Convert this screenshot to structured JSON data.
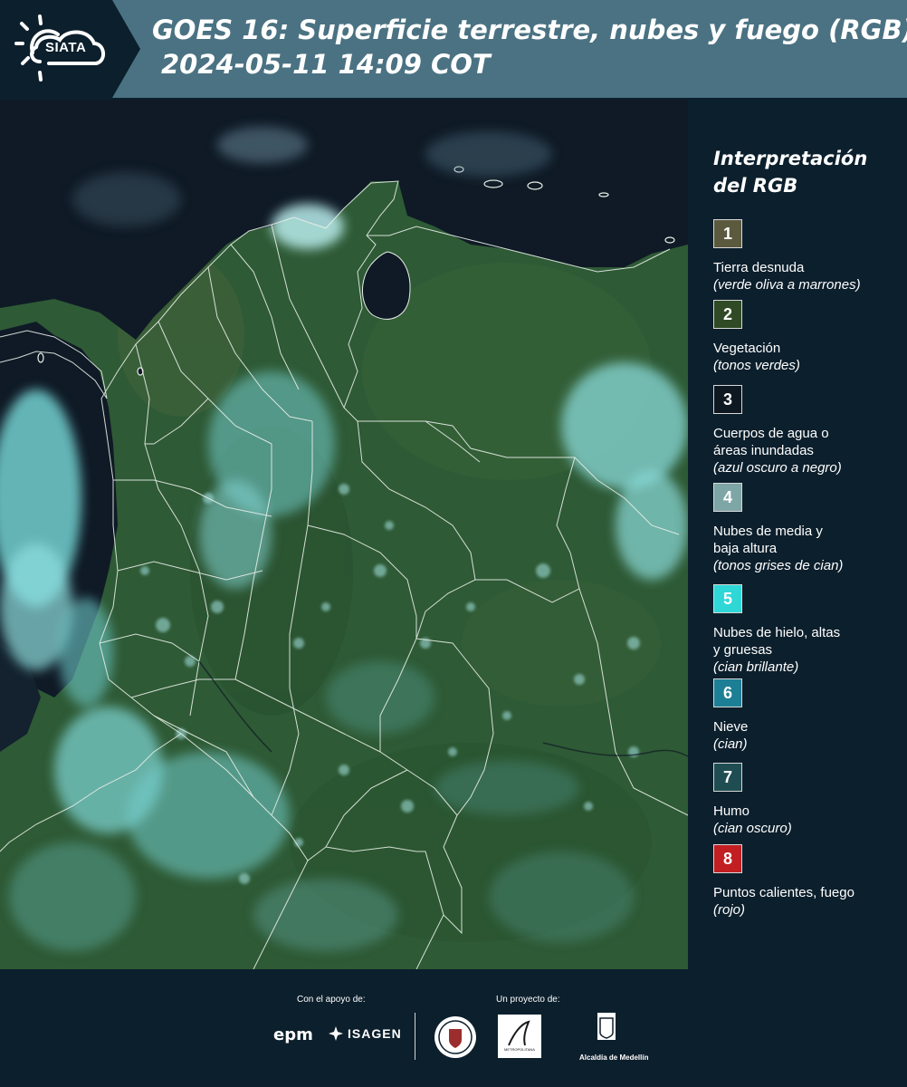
{
  "header": {
    "logo_text": "SIATA",
    "title": "GOES 16: Superficie terrestre, nubes y fuego (RGB)",
    "timestamp": "2024-05-11 14:09 COT"
  },
  "legend": {
    "title": "Interpretación del RGB",
    "items": [
      {
        "number": "1",
        "label": "Tierra desnuda",
        "note": "(verde oliva a marrones)",
        "color": "#5b5a3e"
      },
      {
        "number": "2",
        "label": "Vegetación",
        "note": "(tonos verdes)",
        "color": "#2f4a24"
      },
      {
        "number": "3",
        "label": "Cuerpos de agua o áreas inundadas",
        "note": "(azul oscuro a negro)",
        "color": "#0e1820"
      },
      {
        "number": "4",
        "label": "Nubes de media y baja altura",
        "note": "(tonos grises de cian)",
        "color": "#7fa6a6"
      },
      {
        "number": "5",
        "label": "Nubes de hielo, altas y gruesas",
        "note": "(cian brillante)",
        "color": "#2fd7d7"
      },
      {
        "number": "6",
        "label": "Nieve",
        "note": "(cian)",
        "color": "#1d7f95"
      },
      {
        "number": "7",
        "label": "Humo",
        "note": "(cian oscuro)",
        "color": "#1f4d52"
      },
      {
        "number": "8",
        "label": "Puntos calientes, fuego",
        "note": "(rojo)",
        "color": "#c11f22"
      }
    ]
  },
  "footer": {
    "support_label": "Con el apoyo de:",
    "project_label": "Un proyecto de:",
    "sponsors": [
      "epm",
      "ISAGEN"
    ],
    "partners": [
      "METROPOLITANA",
      "Alcaldía de Medellín"
    ]
  },
  "map": {
    "colors": {
      "land": "#2e5a35",
      "ocean": "#0f1a26",
      "cloud": "#79d4d4",
      "border": "#e8efe8"
    }
  }
}
